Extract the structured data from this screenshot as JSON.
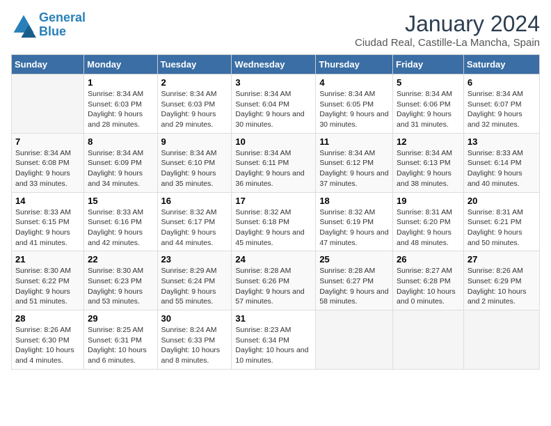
{
  "logo": {
    "line1": "General",
    "line2": "Blue"
  },
  "title": "January 2024",
  "subtitle": "Ciudad Real, Castille-La Mancha, Spain",
  "days_of_week": [
    "Sunday",
    "Monday",
    "Tuesday",
    "Wednesday",
    "Thursday",
    "Friday",
    "Saturday"
  ],
  "weeks": [
    [
      {
        "day": "",
        "sunrise": "",
        "sunset": "",
        "daylight": ""
      },
      {
        "day": "1",
        "sunrise": "Sunrise: 8:34 AM",
        "sunset": "Sunset: 6:03 PM",
        "daylight": "Daylight: 9 hours and 28 minutes."
      },
      {
        "day": "2",
        "sunrise": "Sunrise: 8:34 AM",
        "sunset": "Sunset: 6:03 PM",
        "daylight": "Daylight: 9 hours and 29 minutes."
      },
      {
        "day": "3",
        "sunrise": "Sunrise: 8:34 AM",
        "sunset": "Sunset: 6:04 PM",
        "daylight": "Daylight: 9 hours and 30 minutes."
      },
      {
        "day": "4",
        "sunrise": "Sunrise: 8:34 AM",
        "sunset": "Sunset: 6:05 PM",
        "daylight": "Daylight: 9 hours and 30 minutes."
      },
      {
        "day": "5",
        "sunrise": "Sunrise: 8:34 AM",
        "sunset": "Sunset: 6:06 PM",
        "daylight": "Daylight: 9 hours and 31 minutes."
      },
      {
        "day": "6",
        "sunrise": "Sunrise: 8:34 AM",
        "sunset": "Sunset: 6:07 PM",
        "daylight": "Daylight: 9 hours and 32 minutes."
      }
    ],
    [
      {
        "day": "7",
        "sunrise": "Sunrise: 8:34 AM",
        "sunset": "Sunset: 6:08 PM",
        "daylight": "Daylight: 9 hours and 33 minutes."
      },
      {
        "day": "8",
        "sunrise": "Sunrise: 8:34 AM",
        "sunset": "Sunset: 6:09 PM",
        "daylight": "Daylight: 9 hours and 34 minutes."
      },
      {
        "day": "9",
        "sunrise": "Sunrise: 8:34 AM",
        "sunset": "Sunset: 6:10 PM",
        "daylight": "Daylight: 9 hours and 35 minutes."
      },
      {
        "day": "10",
        "sunrise": "Sunrise: 8:34 AM",
        "sunset": "Sunset: 6:11 PM",
        "daylight": "Daylight: 9 hours and 36 minutes."
      },
      {
        "day": "11",
        "sunrise": "Sunrise: 8:34 AM",
        "sunset": "Sunset: 6:12 PM",
        "daylight": "Daylight: 9 hours and 37 minutes."
      },
      {
        "day": "12",
        "sunrise": "Sunrise: 8:34 AM",
        "sunset": "Sunset: 6:13 PM",
        "daylight": "Daylight: 9 hours and 38 minutes."
      },
      {
        "day": "13",
        "sunrise": "Sunrise: 8:33 AM",
        "sunset": "Sunset: 6:14 PM",
        "daylight": "Daylight: 9 hours and 40 minutes."
      }
    ],
    [
      {
        "day": "14",
        "sunrise": "Sunrise: 8:33 AM",
        "sunset": "Sunset: 6:15 PM",
        "daylight": "Daylight: 9 hours and 41 minutes."
      },
      {
        "day": "15",
        "sunrise": "Sunrise: 8:33 AM",
        "sunset": "Sunset: 6:16 PM",
        "daylight": "Daylight: 9 hours and 42 minutes."
      },
      {
        "day": "16",
        "sunrise": "Sunrise: 8:32 AM",
        "sunset": "Sunset: 6:17 PM",
        "daylight": "Daylight: 9 hours and 44 minutes."
      },
      {
        "day": "17",
        "sunrise": "Sunrise: 8:32 AM",
        "sunset": "Sunset: 6:18 PM",
        "daylight": "Daylight: 9 hours and 45 minutes."
      },
      {
        "day": "18",
        "sunrise": "Sunrise: 8:32 AM",
        "sunset": "Sunset: 6:19 PM",
        "daylight": "Daylight: 9 hours and 47 minutes."
      },
      {
        "day": "19",
        "sunrise": "Sunrise: 8:31 AM",
        "sunset": "Sunset: 6:20 PM",
        "daylight": "Daylight: 9 hours and 48 minutes."
      },
      {
        "day": "20",
        "sunrise": "Sunrise: 8:31 AM",
        "sunset": "Sunset: 6:21 PM",
        "daylight": "Daylight: 9 hours and 50 minutes."
      }
    ],
    [
      {
        "day": "21",
        "sunrise": "Sunrise: 8:30 AM",
        "sunset": "Sunset: 6:22 PM",
        "daylight": "Daylight: 9 hours and 51 minutes."
      },
      {
        "day": "22",
        "sunrise": "Sunrise: 8:30 AM",
        "sunset": "Sunset: 6:23 PM",
        "daylight": "Daylight: 9 hours and 53 minutes."
      },
      {
        "day": "23",
        "sunrise": "Sunrise: 8:29 AM",
        "sunset": "Sunset: 6:24 PM",
        "daylight": "Daylight: 9 hours and 55 minutes."
      },
      {
        "day": "24",
        "sunrise": "Sunrise: 8:28 AM",
        "sunset": "Sunset: 6:26 PM",
        "daylight": "Daylight: 9 hours and 57 minutes."
      },
      {
        "day": "25",
        "sunrise": "Sunrise: 8:28 AM",
        "sunset": "Sunset: 6:27 PM",
        "daylight": "Daylight: 9 hours and 58 minutes."
      },
      {
        "day": "26",
        "sunrise": "Sunrise: 8:27 AM",
        "sunset": "Sunset: 6:28 PM",
        "daylight": "Daylight: 10 hours and 0 minutes."
      },
      {
        "day": "27",
        "sunrise": "Sunrise: 8:26 AM",
        "sunset": "Sunset: 6:29 PM",
        "daylight": "Daylight: 10 hours and 2 minutes."
      }
    ],
    [
      {
        "day": "28",
        "sunrise": "Sunrise: 8:26 AM",
        "sunset": "Sunset: 6:30 PM",
        "daylight": "Daylight: 10 hours and 4 minutes."
      },
      {
        "day": "29",
        "sunrise": "Sunrise: 8:25 AM",
        "sunset": "Sunset: 6:31 PM",
        "daylight": "Daylight: 10 hours and 6 minutes."
      },
      {
        "day": "30",
        "sunrise": "Sunrise: 8:24 AM",
        "sunset": "Sunset: 6:33 PM",
        "daylight": "Daylight: 10 hours and 8 minutes."
      },
      {
        "day": "31",
        "sunrise": "Sunrise: 8:23 AM",
        "sunset": "Sunset: 6:34 PM",
        "daylight": "Daylight: 10 hours and 10 minutes."
      },
      {
        "day": "",
        "sunrise": "",
        "sunset": "",
        "daylight": ""
      },
      {
        "day": "",
        "sunrise": "",
        "sunset": "",
        "daylight": ""
      },
      {
        "day": "",
        "sunrise": "",
        "sunset": "",
        "daylight": ""
      }
    ]
  ]
}
